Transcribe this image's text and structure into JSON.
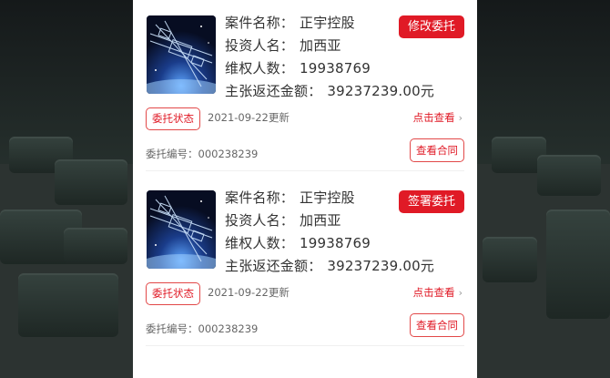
{
  "cases": [
    {
      "name_label": "案件名称：",
      "name_value": "正宇控股",
      "investor_label": "投资人名：",
      "investor_value": "加西亚",
      "count_label": "维权人数：",
      "count_value": "19938769",
      "amount_label": "主张返还金额：",
      "amount_value": "39237239.00元",
      "action_label": "修改委托",
      "status_tag": "委托状态",
      "date_text": "2021-09-22更新",
      "view_link": "点击查看",
      "entrust_no": "委托编号：000238239",
      "contract_button": "查看合同"
    },
    {
      "name_label": "案件名称：",
      "name_value": "正宇控股",
      "investor_label": "投资人名：",
      "investor_value": "加西亚",
      "count_label": "维权人数：",
      "count_value": "19938769",
      "amount_label": "主张返还金额：",
      "amount_value": "39237239.00元",
      "action_label": "签署委托",
      "status_tag": "委托状态",
      "date_text": "2021-09-22更新",
      "view_link": "点击查看",
      "entrust_no": "委托编号：000238239",
      "contract_button": "查看合同"
    }
  ],
  "icons": {
    "chevron": "chevron-right-icon",
    "thumbnail": "satellite-thumbnail"
  },
  "colors": {
    "accent": "#e01a26",
    "text": "#333333",
    "muted": "#666666"
  }
}
